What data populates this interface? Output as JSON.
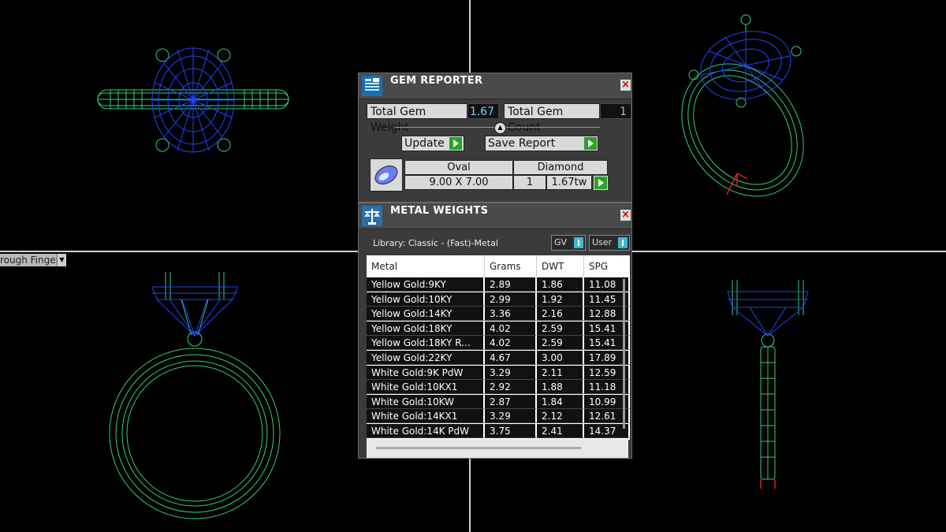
{
  "viewport": {
    "label": "rough Finger"
  },
  "gem_reporter": {
    "title": "GEM REPORTER",
    "total_weight_label": "Total Gem Weight",
    "total_weight_value": "1.67",
    "total_count_label": "Total Gem Count",
    "total_count_value": "1",
    "update_label": "Update",
    "save_report_label": "Save Report",
    "gem": {
      "shape": "Oval",
      "type": "Diamond",
      "size": "9.00 X 7.00",
      "count": "1",
      "weight": "1.67tw"
    }
  },
  "metal_weights": {
    "title": "METAL WEIGHTS",
    "library": "Library: Classic - (Fast)-Metal",
    "gv_label": "GV",
    "user_label": "User",
    "columns": [
      "Metal",
      "Grams",
      "DWT",
      "SPG"
    ],
    "rows": [
      {
        "metal": "Yellow Gold:9KY",
        "grams": "2.89",
        "dwt": "1.86",
        "spg": "11.08"
      },
      {
        "metal": "Yellow Gold:10KY",
        "grams": "2.99",
        "dwt": "1.92",
        "spg": "11.45"
      },
      {
        "metal": "Yellow Gold:14KY",
        "grams": "3.36",
        "dwt": "2.16",
        "spg": "12.88"
      },
      {
        "metal": "Yellow Gold:18KY",
        "grams": "4.02",
        "dwt": "2.59",
        "spg": "15.41"
      },
      {
        "metal": "Yellow Gold:18KY R...",
        "grams": "4.02",
        "dwt": "2.59",
        "spg": "15.41"
      },
      {
        "metal": "Yellow Gold:22KY",
        "grams": "4.67",
        "dwt": "3.00",
        "spg": "17.89"
      },
      {
        "metal": "White Gold:9K PdW",
        "grams": "3.29",
        "dwt": "2.11",
        "spg": "12.59"
      },
      {
        "metal": "White Gold:10KX1",
        "grams": "2.92",
        "dwt": "1.88",
        "spg": "11.18"
      },
      {
        "metal": "White Gold:10KW",
        "grams": "2.87",
        "dwt": "1.84",
        "spg": "10.99"
      },
      {
        "metal": "White Gold:14KX1",
        "grams": "3.29",
        "dwt": "2.12",
        "spg": "12.61"
      },
      {
        "metal": "White Gold:14K PdW",
        "grams": "3.75",
        "dwt": "2.41",
        "spg": "14.37"
      }
    ]
  },
  "colors": {
    "wire_green": "#2fd07a",
    "wire_blue": "#2244ff",
    "accent_cyan": "#3db7d6",
    "go_green": "#2aa22a"
  }
}
